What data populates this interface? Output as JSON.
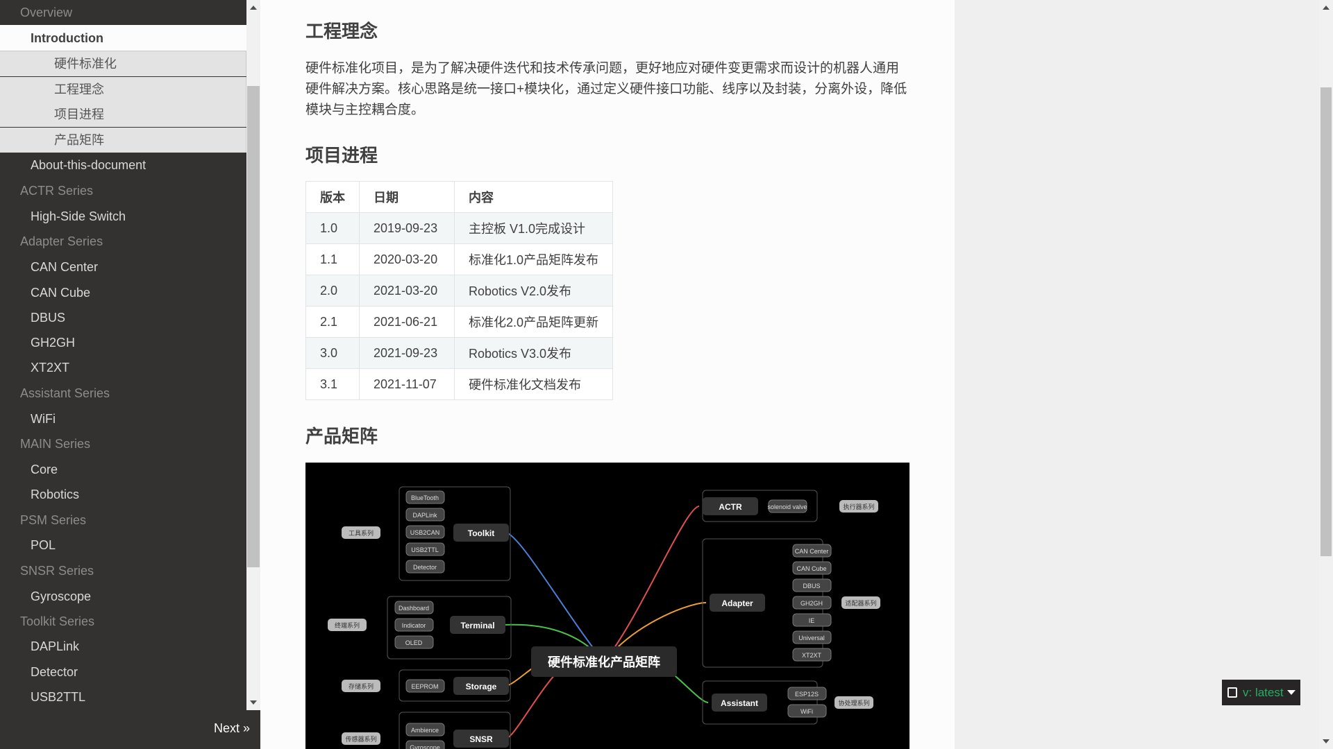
{
  "sidebar": {
    "items": [
      {
        "label": "Overview",
        "kind": "caption"
      },
      {
        "label": "Introduction",
        "kind": "current"
      },
      {
        "label": "硬件标准化",
        "kind": "sub"
      },
      {
        "label": "工程理念",
        "kind": "sub"
      },
      {
        "label": "项目进程",
        "kind": "sub"
      },
      {
        "label": "产品矩阵",
        "kind": "sub"
      },
      {
        "label": "About-this-document",
        "kind": "l1"
      },
      {
        "label": "ACTR Series",
        "kind": "caption"
      },
      {
        "label": "High-Side Switch",
        "kind": "l1"
      },
      {
        "label": "Adapter Series",
        "kind": "caption"
      },
      {
        "label": "CAN Center",
        "kind": "l1"
      },
      {
        "label": "CAN Cube",
        "kind": "l1"
      },
      {
        "label": "DBUS",
        "kind": "l1"
      },
      {
        "label": "GH2GH",
        "kind": "l1"
      },
      {
        "label": "XT2XT",
        "kind": "l1"
      },
      {
        "label": "Assistant Series",
        "kind": "caption"
      },
      {
        "label": "WiFi",
        "kind": "l1"
      },
      {
        "label": "MAIN Series",
        "kind": "caption"
      },
      {
        "label": "Core",
        "kind": "l1"
      },
      {
        "label": "Robotics",
        "kind": "l1"
      },
      {
        "label": "PSM Series",
        "kind": "caption"
      },
      {
        "label": "POL",
        "kind": "l1"
      },
      {
        "label": "SNSR Series",
        "kind": "caption"
      },
      {
        "label": "Gyroscope",
        "kind": "l1"
      },
      {
        "label": "Toolkit Series",
        "kind": "caption"
      },
      {
        "label": "DAPLink",
        "kind": "l1"
      },
      {
        "label": "Detector",
        "kind": "l1"
      },
      {
        "label": "USB2TTL",
        "kind": "l1"
      }
    ],
    "next_label": "Next »"
  },
  "content": {
    "section1_title": "工程理念",
    "section1_body": "硬件标准化项目，是为了解决硬件迭代和技术传承问题，更好地应对硬件变更需求而设计的机器人通用硬件解决方案。核心思路是统一接口+模块化，通过定义硬件接口功能、线序以及封装，分离外设，降低模块与主控耦合度。",
    "section2_title": "项目进程",
    "table": {
      "headers": [
        "版本",
        "日期",
        "内容"
      ],
      "rows": [
        [
          "1.0",
          "2019-09-23",
          "主控板 V1.0完成设计"
        ],
        [
          "1.1",
          "2020-03-20",
          "标准化1.0产品矩阵发布"
        ],
        [
          "2.0",
          "2021-03-20",
          "Robotics V2.0发布"
        ],
        [
          "2.1",
          "2021-06-21",
          "标准化2.0产品矩阵更新"
        ],
        [
          "3.0",
          "2021-09-23",
          "Robotics V3.0发布"
        ],
        [
          "3.1",
          "2021-11-07",
          "硬件标准化文档发布"
        ]
      ]
    },
    "section3_title": "产品矩阵"
  },
  "matrix": {
    "center": "硬件标准化产品矩阵",
    "left_groups": [
      {
        "name": "Toolkit",
        "tag": "工具系列",
        "items": [
          "BlueTooth",
          "DAPLink",
          "USB2CAN",
          "USB2TTL",
          "Detector"
        ],
        "color": "#4d7fd6"
      },
      {
        "name": "Terminal",
        "tag": "终端系列",
        "items": [
          "Dashboard",
          "Indicator",
          "OLED"
        ],
        "color": "#4cc04c"
      },
      {
        "name": "Storage",
        "tag": "存储系列",
        "items": [
          "EEPROM"
        ],
        "color": "#f0a030"
      },
      {
        "name": "SNSR",
        "tag": "传感器系列",
        "items": [
          "Ambience",
          "Gyroscope"
        ],
        "color": "#e05050"
      }
    ],
    "right_groups": [
      {
        "name": "ACTR",
        "tag": "执行器系列",
        "items": [
          "solenoid valve"
        ],
        "color": "#e05050"
      },
      {
        "name": "Adapter",
        "tag": "适配器系列",
        "items": [
          "CAN Center",
          "CAN Cube",
          "DBUS",
          "GH2GH",
          "IE",
          "Universal",
          "XT2XT"
        ],
        "color": "#f0a030"
      },
      {
        "name": "Assistant",
        "tag": "协处理系列",
        "items": [
          "ESP12S",
          "WiFi"
        ],
        "color": "#4cc04c"
      }
    ]
  },
  "version": {
    "label": "v: latest"
  }
}
